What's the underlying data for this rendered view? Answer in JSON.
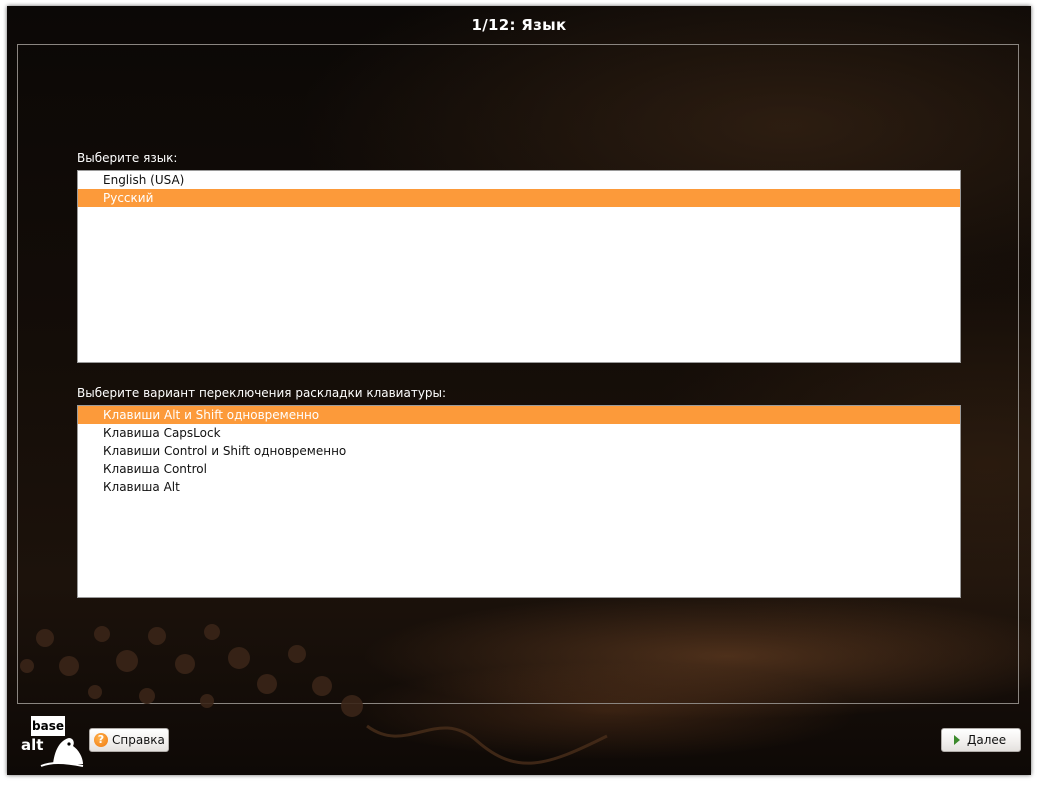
{
  "window": {
    "title": "1/12: Язык"
  },
  "language": {
    "label": "Выберите язык:",
    "items": [
      {
        "label": "English (USA)",
        "selected": false
      },
      {
        "label": "Русский",
        "selected": true
      }
    ]
  },
  "layout_switch": {
    "label": "Выберите вариант переключения раскладки клавиатуры:",
    "items": [
      {
        "label": "Клавиши Alt и Shift одновременно",
        "selected": true
      },
      {
        "label": "Клавиша CapsLock",
        "selected": false
      },
      {
        "label": "Клавиши Control и Shift одновременно",
        "selected": false
      },
      {
        "label": "Клавиша Control",
        "selected": false
      },
      {
        "label": "Клавиша Alt",
        "selected": false
      }
    ]
  },
  "footer": {
    "logo_top": "base",
    "logo_bottom": "alt",
    "help_label": "Справка",
    "next_label": "Далее"
  },
  "colors": {
    "selection": "#fc9a3a",
    "background": "#140d08",
    "next_arrow": "#3c8a2c",
    "help_icon": "#f07a10"
  },
  "icons": {
    "help": "help-icon",
    "next": "arrow-right-icon",
    "logo": "basealt-logo-icon"
  }
}
